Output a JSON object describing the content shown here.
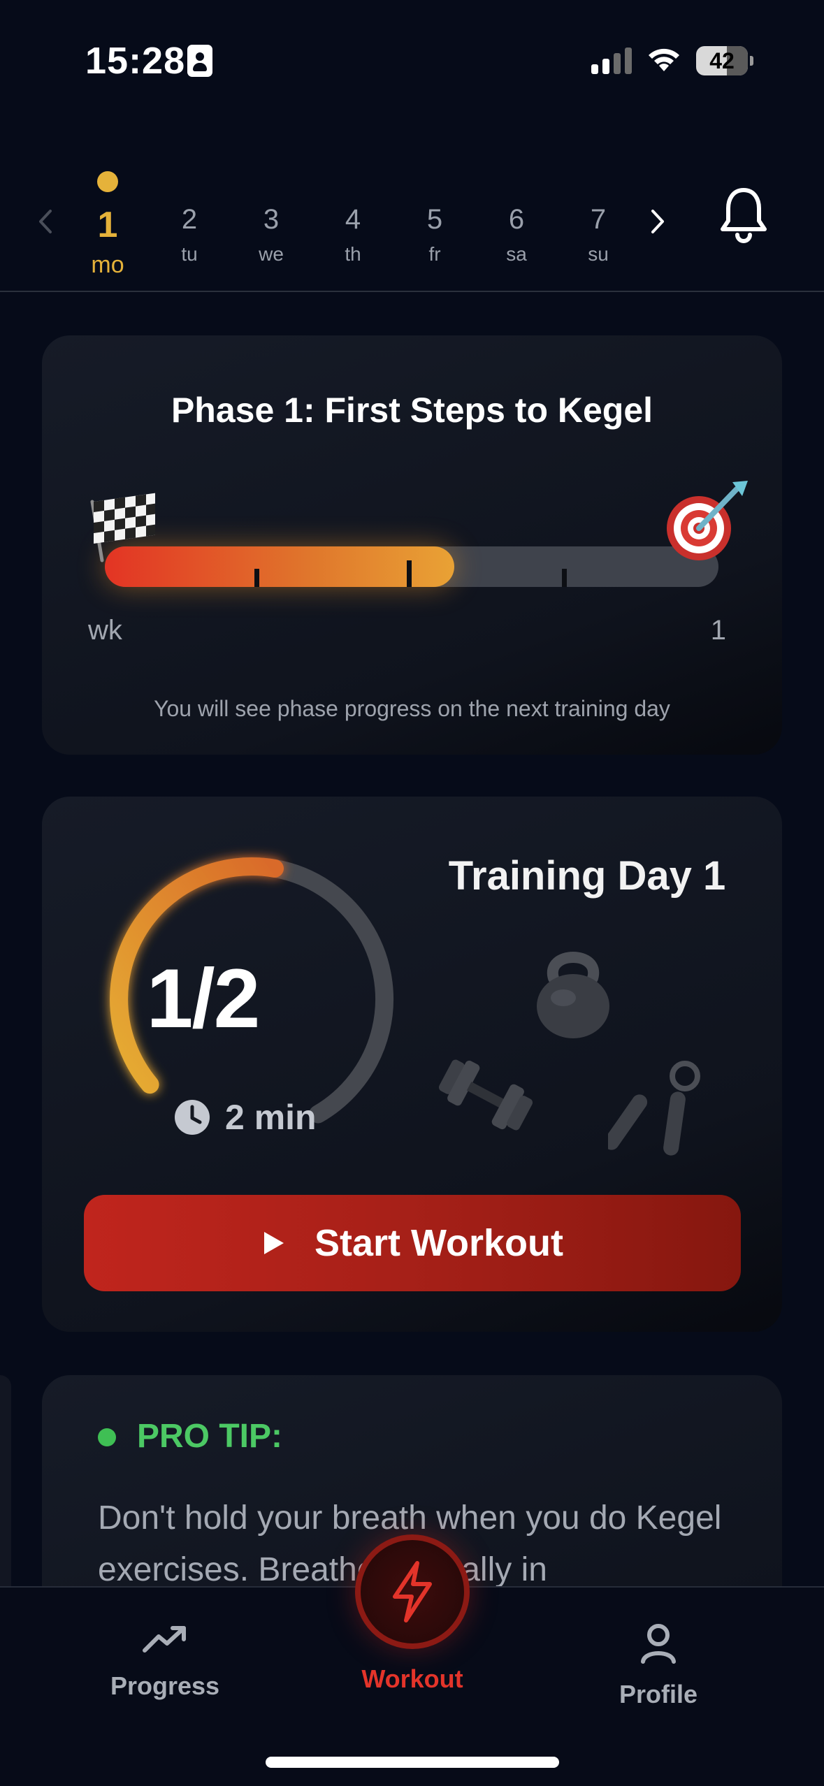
{
  "status_bar": {
    "time": "15:28",
    "battery": "42",
    "icons": [
      "id-card-icon",
      "signal-icon",
      "wifi-icon",
      "battery-icon"
    ]
  },
  "week": {
    "selected_index": 0,
    "days": [
      {
        "num": "1",
        "label": "mo"
      },
      {
        "num": "2",
        "label": "tu"
      },
      {
        "num": "3",
        "label": "we"
      },
      {
        "num": "4",
        "label": "th"
      },
      {
        "num": "5",
        "label": "fr"
      },
      {
        "num": "6",
        "label": "sa"
      },
      {
        "num": "7",
        "label": "su"
      }
    ],
    "icons": [
      "chevron-left-icon",
      "chevron-right-icon",
      "bell-icon"
    ]
  },
  "phase": {
    "title": "Phase 1: First Steps to Kegel",
    "progress_fraction": 0.57,
    "start_label": "wk",
    "end_label": "1",
    "note": "You will see phase progress on the next training day",
    "icons": [
      "checkered-flag-icon",
      "target-dart-icon"
    ]
  },
  "training": {
    "title": "Training Day 1",
    "count": "1/2",
    "progress_fraction": 0.5,
    "duration": "2 min",
    "button_label": "Start Workout",
    "icons": [
      "clock-icon",
      "kettlebell-icon",
      "dumbbell-icon",
      "hand-gripper-icon",
      "play-icon"
    ]
  },
  "tip": {
    "title": "PRO TIP:",
    "text": "Don't hold your breath when you do Kegel exercises. Breathe normally in"
  },
  "nav": {
    "items": [
      {
        "label": "Progress",
        "icon": "trending-up-icon"
      },
      {
        "label": "Workout",
        "icon": "lightning-icon"
      },
      {
        "label": "Profile",
        "icon": "user-icon"
      }
    ],
    "active": "Workout"
  },
  "colors": {
    "accent_gold": "#e5b23a",
    "accent_red": "#e3342a",
    "tip_green": "#4cc964",
    "background": "#060b19"
  }
}
